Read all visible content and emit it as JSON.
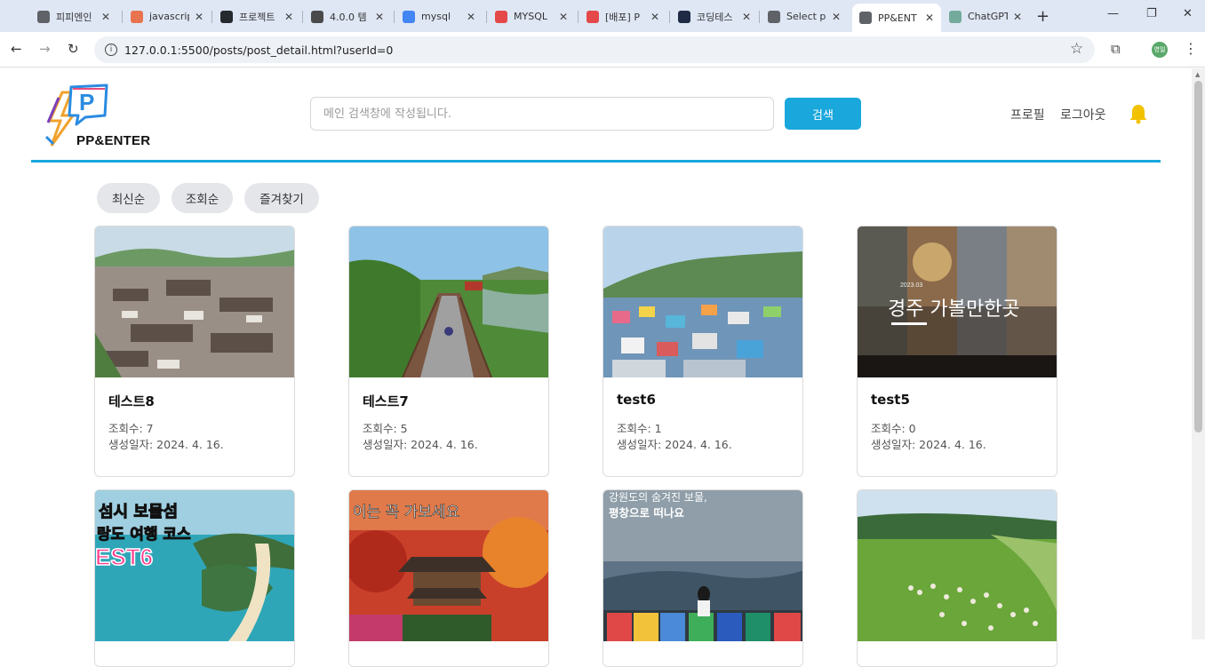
{
  "browser": {
    "tabs": [
      {
        "label": "피피엔인",
        "favicon": "folder-icon",
        "color": "#5f6368",
        "active": false
      },
      {
        "label": "javascrip",
        "favicon": "pen-icon",
        "color": "#e8744f",
        "active": false
      },
      {
        "label": "프로젝트",
        "favicon": "github-icon",
        "color": "#24292e",
        "active": false
      },
      {
        "label": "4.0.0 템",
        "favicon": "book-icon",
        "color": "#4a4a4a",
        "active": false
      },
      {
        "label": "mysql",
        "favicon": "google-icon",
        "color": "#4285f4",
        "active": false
      },
      {
        "label": "MYSQL",
        "favicon": "velog-icon",
        "color": "#e54848",
        "active": false
      },
      {
        "label": "[배포] P",
        "favicon": "velog-icon",
        "color": "#e54848",
        "active": false
      },
      {
        "label": "코딩테스",
        "favicon": "tistory-icon",
        "color": "#1f2a44",
        "active": false
      },
      {
        "label": "Select p",
        "favicon": "globe-icon",
        "color": "#5f6368",
        "active": false
      },
      {
        "label": "PP&ENT",
        "favicon": "globe-icon",
        "color": "#5f6368",
        "active": true
      },
      {
        "label": "ChatGPT",
        "favicon": "chatgpt-icon",
        "color": "#74aa9c",
        "active": false
      }
    ],
    "url": "127.0.0.1:5500/posts/post_detail.html?userId=0",
    "profile_label": "영일"
  },
  "header": {
    "logo_text": "PP&ENTER",
    "search_placeholder": "메인 검색창에 작성됩니다.",
    "search_button": "검색",
    "nav": {
      "profile": "프로필",
      "logout": "로그아웃"
    },
    "accent": "#1aa7dc"
  },
  "filters": [
    "최신순",
    "조회순",
    "즐겨찾기"
  ],
  "posts": [
    {
      "title": "테스트8",
      "views": "조회수: 7",
      "date": "생성일자: 2024. 4. 16.",
      "image": "korean-village-photo"
    },
    {
      "title": "테스트7",
      "views": "조회수: 5",
      "date": "생성일자: 2024. 4. 16.",
      "image": "suspension-bridge-photo"
    },
    {
      "title": "test6",
      "views": "조회수: 1",
      "date": "생성일자: 2024. 4. 16.",
      "image": "colorful-hillside-village-photo"
    },
    {
      "title": "test5",
      "views": "조회수: 0",
      "date": "생성일자: 2024. 4. 16.",
      "image": "gyeongju-collage-photo"
    },
    {
      "title": "",
      "views": "",
      "date": "",
      "image": "island-travel-poster",
      "overlay": [
        "섬시 보물섬",
        "랑도 여행 코스",
        "EST6"
      ]
    },
    {
      "title": "",
      "views": "",
      "date": "",
      "image": "temple-autumn-photo",
      "overlay": [
        "이는 꼭 가보세요"
      ]
    },
    {
      "title": "",
      "views": "",
      "date": "",
      "image": "mountain-view-poster",
      "overlay": [
        "강원도의 숨겨진 보물,",
        "평창으로 떠나요"
      ]
    },
    {
      "title": "",
      "views": "",
      "date": "",
      "image": "sheep-pasture-photo"
    }
  ],
  "card_overlay_captions": {
    "card4": "경주 가볼만한곳",
    "card4_sub": "2023.03"
  }
}
